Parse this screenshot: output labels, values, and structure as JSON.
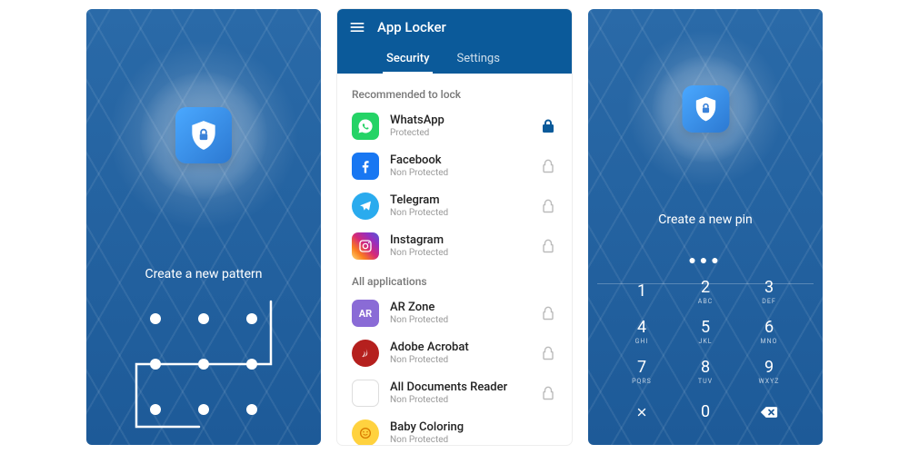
{
  "screen1": {
    "prompt": "Create a new pattern"
  },
  "screen2": {
    "title": "App Locker",
    "tabs": {
      "security": "Security",
      "settings": "Settings"
    },
    "section_recommended": "Recommended to lock",
    "section_all": "All applications",
    "apps_recommended": [
      {
        "name": "WhatsApp",
        "status": "Protected",
        "locked": true
      },
      {
        "name": "Facebook",
        "status": "Non Protected",
        "locked": false
      },
      {
        "name": "Telegram",
        "status": "Non Protected",
        "locked": false
      },
      {
        "name": "Instagram",
        "status": "Non Protected",
        "locked": false
      }
    ],
    "apps_all": [
      {
        "name": "AR Zone",
        "status": "Non Protected",
        "locked": false
      },
      {
        "name": "Adobe Acrobat",
        "status": "Non Protected",
        "locked": false
      },
      {
        "name": "All Documents Reader",
        "status": "Non Protected",
        "locked": false
      },
      {
        "name": "Baby Coloring",
        "status": "Non Protected",
        "locked": false
      }
    ]
  },
  "screen3": {
    "prompt": "Create a new pin",
    "entered_count": 3,
    "keys": [
      {
        "num": "1",
        "letters": ""
      },
      {
        "num": "2",
        "letters": "ABC"
      },
      {
        "num": "3",
        "letters": "DEF"
      },
      {
        "num": "4",
        "letters": "GHI"
      },
      {
        "num": "5",
        "letters": "JKL"
      },
      {
        "num": "6",
        "letters": "MNO"
      },
      {
        "num": "7",
        "letters": "PQRS"
      },
      {
        "num": "8",
        "letters": "TUV"
      },
      {
        "num": "9",
        "letters": "WXYZ"
      }
    ]
  },
  "colors": {
    "whatsapp": "#25D366",
    "facebook": "#1877F2",
    "telegram": "#2AABEE",
    "arzone": "#8a6bd6",
    "acrobat": "#b5201e"
  }
}
